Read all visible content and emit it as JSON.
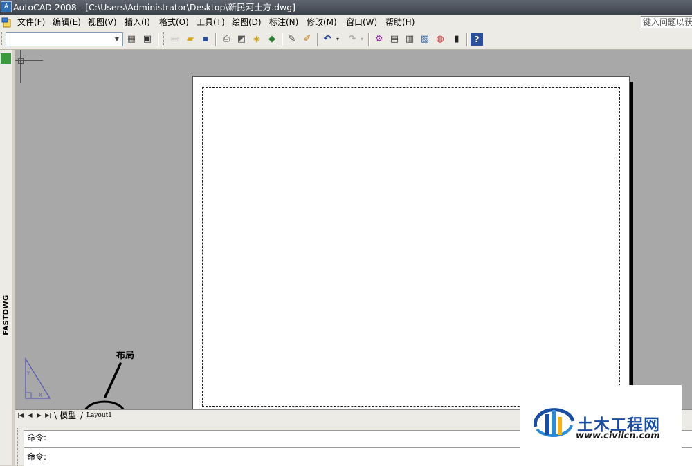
{
  "window": {
    "title": "AutoCAD 2008 - [C:\\Users\\Administrator\\Desktop\\新民河土方.dwg]"
  },
  "menubar": {
    "items": [
      "文件(F)",
      "编辑(E)",
      "视图(V)",
      "插入(I)",
      "格式(O)",
      "工具(T)",
      "绘图(D)",
      "标注(N)",
      "修改(M)",
      "窗口(W)",
      "帮助(H)"
    ],
    "help_search_placeholder": "键入问题以获取帮助"
  },
  "toolbar": {
    "combo_value": "",
    "icons": [
      "layer-state-icon",
      "layer-previous-icon",
      "new-icon",
      "open-icon",
      "save-icon",
      "plot-icon",
      "plot-preview-icon",
      "publish-icon",
      "3d-dwf-icon",
      "match-properties-icon",
      "paint-icon",
      "undo-icon",
      "redo-icon",
      "properties-icon",
      "design-center-icon",
      "tool-palettes-icon",
      "sheet-set-icon",
      "markup-icon",
      "calculator-icon",
      "help-icon"
    ]
  },
  "left_panel": {
    "label": "FASTDWG"
  },
  "annotation": {
    "label": "布局"
  },
  "layout_tabs": {
    "tabs": [
      "模型",
      "Layout1"
    ],
    "active": "Layout1"
  },
  "command": {
    "lines": [
      "命令:",
      "命令:"
    ]
  },
  "watermark": {
    "name": "土木工程网",
    "url": "www.civilcn.com"
  },
  "colors": {
    "canvas_bg": "#a8a8a8",
    "paper": "#ffffff",
    "chrome": "#ecebe6",
    "watermark_blue": "#1a4da0"
  }
}
